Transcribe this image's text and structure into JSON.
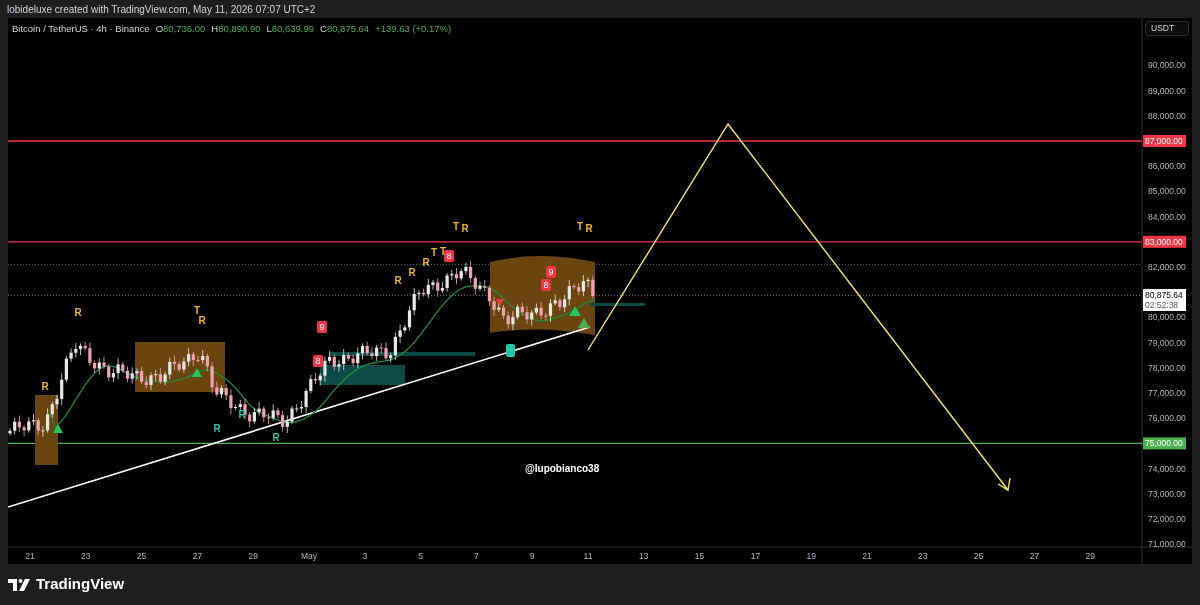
{
  "header": {
    "caption": "lobideluxe created with TradingView.com, May 11, 2026 07:07 UTC+2"
  },
  "legend": {
    "symbol": "Bitcoin / TetherUS · 4h · Binance",
    "quotes": [
      {
        "label": "O",
        "value": "80,736.00"
      },
      {
        "label": "H",
        "value": "80,890.90"
      },
      {
        "label": "L",
        "value": "80,639.99"
      },
      {
        "label": "C",
        "value": "80,875.64"
      }
    ],
    "change": "+139.63 (+0.17%)"
  },
  "currency_button": "USDT",
  "price_axis": [
    "90,000.00",
    "89,000.00",
    "88,000.00",
    "86,000.00",
    "85,000.00",
    "84,000.00",
    "82,000.00",
    "80,000.00",
    "79,000.00",
    "78,000.00",
    "77,000.00",
    "76,000.00",
    "74,000.00",
    "73,000.00",
    "72,000.00",
    "71,000.00"
  ],
  "levels": [
    {
      "label": "87,000.00",
      "color": "#f23645"
    },
    {
      "label": "83,000.00",
      "color": "#f23645"
    },
    {
      "label": "75,000.00",
      "color": "#4caf50"
    }
  ],
  "last_price": {
    "price": "80,875.64",
    "countdown": "02:52:38"
  },
  "time_axis": [
    "21",
    "23",
    "25",
    "27",
    "29",
    "May",
    "3",
    "5",
    "7",
    "9",
    "11",
    "13",
    "15",
    "17",
    "19",
    "21",
    "23",
    "25",
    "27",
    "29"
  ],
  "markers": [
    {
      "kind": "signal",
      "text": "R",
      "color": "#f0b429"
    },
    {
      "kind": "signal",
      "text": "R",
      "color": "#f0b429"
    },
    {
      "kind": "signal",
      "text": "T",
      "color": "#f0b429"
    },
    {
      "kind": "signal",
      "text": "R",
      "color": "#f0b429"
    },
    {
      "kind": "signal",
      "text": "R",
      "color": "#f0b429"
    },
    {
      "kind": "signal",
      "text": "R",
      "color": "#f0b429"
    },
    {
      "kind": "signal",
      "text": "R",
      "color": "#f0b429"
    },
    {
      "kind": "signal",
      "text": "T",
      "color": "#f0b429"
    },
    {
      "kind": "signal",
      "text": "T",
      "color": "#f0b429"
    },
    {
      "kind": "signal",
      "text": "T",
      "color": "#f0b429"
    },
    {
      "kind": "signal",
      "text": "R",
      "color": "#f0b429"
    },
    {
      "kind": "signal",
      "text": "T",
      "color": "#f0b429"
    },
    {
      "kind": "signal",
      "text": "R",
      "color": "#f0b429"
    },
    {
      "kind": "signal",
      "text": "R",
      "color": "#26c6a6"
    },
    {
      "kind": "signal",
      "text": "R",
      "color": "#26c6a6"
    },
    {
      "kind": "signal",
      "text": "R",
      "color": "#26c6a6"
    },
    {
      "kind": "count",
      "text": "9"
    },
    {
      "kind": "count",
      "text": "8"
    },
    {
      "kind": "count",
      "text": "8"
    },
    {
      "kind": "count",
      "text": "9"
    },
    {
      "kind": "count",
      "text": "8"
    }
  ],
  "annotation": "@lupobianco38",
  "footer": {
    "logo_text": "TradingView"
  }
}
